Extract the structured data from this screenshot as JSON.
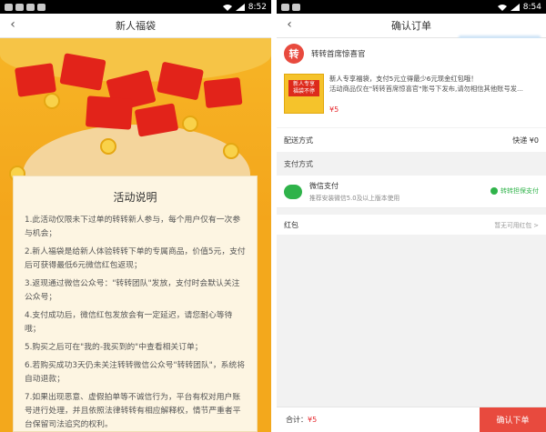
{
  "left": {
    "status_time": "8:52",
    "title": "新人福袋",
    "card_title": "活动说明",
    "rules": [
      "1.此活动仅限未下过单的转转新人参与，每个用户仅有一次参与机会；",
      "2.新人福袋是给新人体验转转下单的专属商品，价值5元，支付后可获得最低6元微信红包返现；",
      "3.返现通过微信公众号：\"转转团队\"发放，支付时会默认关注公众号；",
      "4.支付成功后，微信红包发放会有一定延迟，请您耐心等待哦；",
      "5.购买之后可在\"我的-我买到的\"中查看相关订单；",
      "6.若购买成功3天仍未关注转转微信公众号\"转转团队\"，系统将自动退款；",
      "7.如果出现恶意、虚假拍单等不诚信行为，平台有权对用户账号进行处理，并且依照法律转转有相应解释权，情节严重者平台保留司法追究的权利。"
    ]
  },
  "right": {
    "status_time": "8:54",
    "title": "确认订单",
    "shop_name": "转转首席惊喜官",
    "shop_logo": "转",
    "item_title": "新人专享福袋，支付5元立得最少6元现金红包哦！",
    "item_desc": "活动商品仅在\"转转首席惊喜官\"账号下发布,请勿相信其他账号发...",
    "thumb_text_1": "新人专享",
    "thumb_text_2": "福袋不停",
    "price": "¥5",
    "shipping_label": "配送方式",
    "shipping_value": "快递 ¥0",
    "payment_section": "支付方式",
    "wechat_pay": "微信支付",
    "wechat_pay_sub": "推荐安装微信5.0及以上版本使用",
    "wechat_pay_status": "转转担保支付",
    "redpack_label": "红包",
    "redpack_value": "暂无可用红包 >",
    "total_label": "合计：",
    "total_value": "¥5",
    "confirm_button": "确认下单"
  },
  "colors": {
    "accent_red": "#e84a3e",
    "banner_orange": "#f3a81c",
    "wechat_green": "#2fb34a"
  }
}
